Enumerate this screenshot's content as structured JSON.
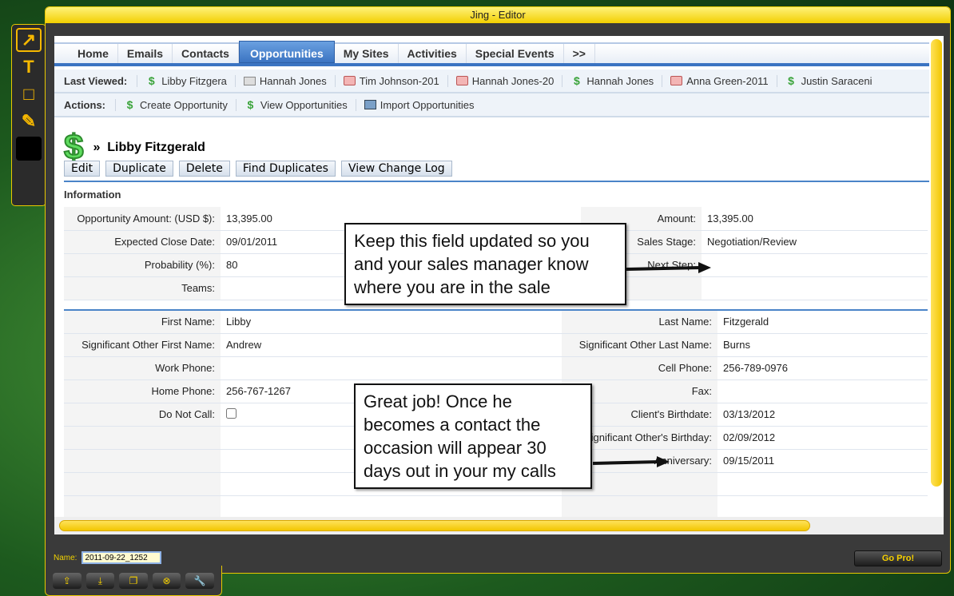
{
  "window": {
    "title": "Jing - Editor"
  },
  "palette": {
    "tools": [
      {
        "icon": "arrow-icon",
        "glyph": "↗"
      },
      {
        "icon": "text-icon",
        "glyph": "T"
      },
      {
        "icon": "rectangle-icon",
        "glyph": "□"
      },
      {
        "icon": "highlighter-icon",
        "glyph": "✎"
      }
    ],
    "color": "#000000"
  },
  "tabs": [
    {
      "label": "Home"
    },
    {
      "label": "Emails"
    },
    {
      "label": "Contacts"
    },
    {
      "label": "Opportunities",
      "active": true
    },
    {
      "label": "My Sites"
    },
    {
      "label": "Activities"
    },
    {
      "label": "Special Events"
    },
    {
      "label": ">>"
    }
  ],
  "last_viewed": {
    "label": "Last Viewed:",
    "items": [
      {
        "label": "Libby Fitzgera",
        "icon": "dollar-icon"
      },
      {
        "label": "Hannah Jones",
        "icon": "document-icon"
      },
      {
        "label": "Tim Johnson-201",
        "icon": "calendar-icon"
      },
      {
        "label": "Hannah Jones-20",
        "icon": "calendar-icon"
      },
      {
        "label": "Hannah Jones",
        "icon": "dollar-icon"
      },
      {
        "label": "Anna Green-2011",
        "icon": "calendar-icon"
      },
      {
        "label": "Justin Saraceni",
        "icon": "dollar-icon"
      }
    ]
  },
  "actions": {
    "label": "Actions:",
    "items": [
      {
        "label": "Create Opportunity",
        "icon": "dollar-plus-icon"
      },
      {
        "label": "View Opportunities",
        "icon": "dollar-icon"
      },
      {
        "label": "Import Opportunities",
        "icon": "import-icon"
      }
    ]
  },
  "record": {
    "title": "Libby Fitzgerald",
    "chevron": "»"
  },
  "buttons": [
    "Edit",
    "Duplicate",
    "Delete",
    "Find Duplicates",
    "View Change Log"
  ],
  "section_title": "Information",
  "info_rows": [
    [
      "Opportunity Amount: (USD $):",
      "13,395.00",
      "Amount:",
      "13,395.00"
    ],
    [
      "Expected Close Date:",
      "09/01/2011",
      "Sales Stage:",
      "Negotiation/Review"
    ],
    [
      "Probability (%):",
      "80",
      "Next Step:",
      ""
    ],
    [
      "Teams:",
      "",
      "",
      ""
    ]
  ],
  "detail_rows": [
    [
      "First Name:",
      "Libby",
      "Last Name:",
      "Fitzgerald"
    ],
    [
      "Significant Other First Name:",
      "Andrew",
      "Significant Other Last Name:",
      "Burns"
    ],
    [
      "Work Phone:",
      "",
      "Cell Phone:",
      "256-789-0976"
    ],
    [
      "Home Phone:",
      "256-767-1267",
      "Fax:",
      ""
    ],
    [
      "Do Not Call:",
      "",
      "Client's Birthdate:",
      "03/13/2012"
    ],
    [
      "",
      "",
      "Significant Other's Birthday:",
      "02/09/2012"
    ],
    [
      "",
      "",
      "Anniversary:",
      "09/15/2011"
    ],
    [
      "",
      "",
      "",
      ""
    ],
    [
      "",
      "",
      "",
      ""
    ],
    [
      "",
      "",
      "",
      ""
    ]
  ],
  "callouts": [
    "Keep this field updated so you and your sales manager know where you are in the sale",
    "Great job! Once he becomes a contact the occasion will appear 30 days out in your my calls"
  ],
  "footer": {
    "name_label": "Name:",
    "name_value": "2011-09-22_1252",
    "go_pro": "Go Pro!",
    "tray": [
      {
        "icon": "share-icon",
        "glyph": "⇪"
      },
      {
        "icon": "save-icon",
        "glyph": "⤓"
      },
      {
        "icon": "copy-icon",
        "glyph": "❐"
      },
      {
        "icon": "cancel-icon",
        "glyph": "⊗"
      },
      {
        "icon": "wrench-icon",
        "glyph": "🔧"
      }
    ]
  }
}
